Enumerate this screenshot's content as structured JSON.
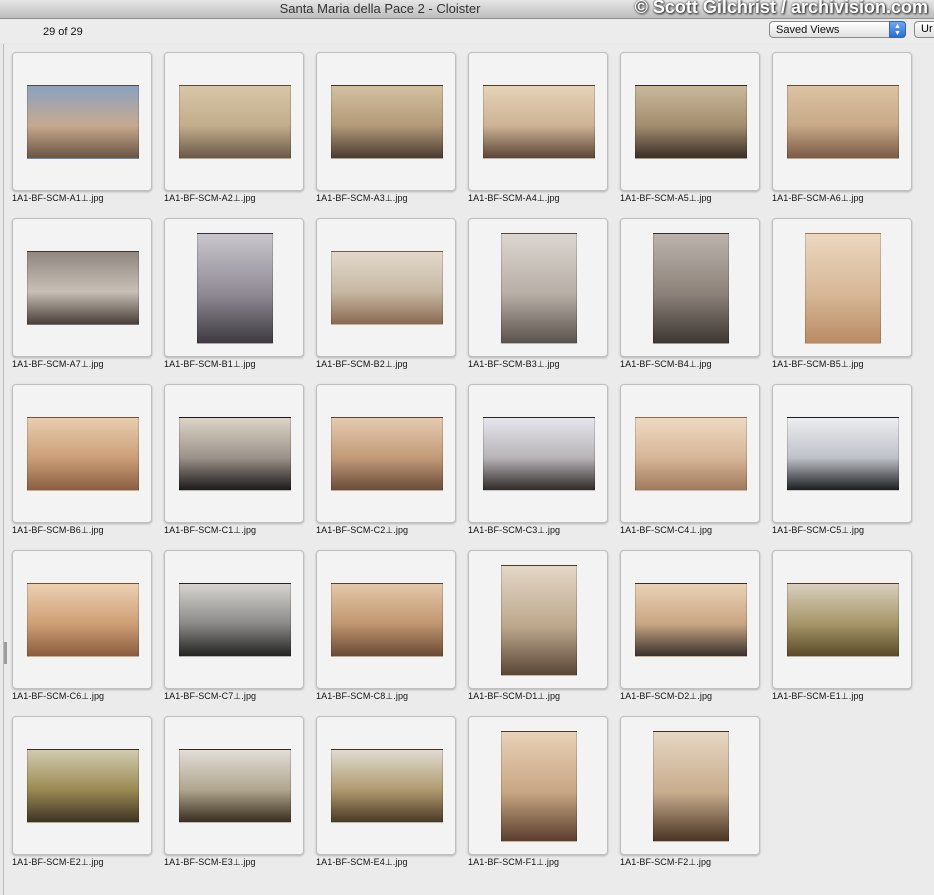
{
  "window": {
    "title": "Santa Maria della Pace 2 - Cloister"
  },
  "watermark": {
    "text": "© Scott Gilchrist / archivision.com"
  },
  "toolbar": {
    "item_count": "29 of 29",
    "saved_views_label": "Saved Views",
    "extra_button_label": "Ur"
  },
  "thumbnails": [
    {
      "filename": "1A1-BF-SCM-A1⊥.jpg",
      "orientation": "landscape",
      "colors": [
        "#8aa2c0",
        "#c7a98e",
        "#6a5444"
      ]
    },
    {
      "filename": "1A1-BF-SCM-A2⊥.jpg",
      "orientation": "landscape",
      "colors": [
        "#d7c6a6",
        "#c2ad8c",
        "#6b5848"
      ]
    },
    {
      "filename": "1A1-BF-SCM-A3⊥.jpg",
      "orientation": "landscape",
      "colors": [
        "#d3c0a0",
        "#b39a78",
        "#4a3a30"
      ]
    },
    {
      "filename": "1A1-BF-SCM-A4⊥.jpg",
      "orientation": "landscape",
      "colors": [
        "#e6d3b8",
        "#cdb394",
        "#5a4636"
      ]
    },
    {
      "filename": "1A1-BF-SCM-A5⊥.jpg",
      "orientation": "landscape",
      "colors": [
        "#c8b89a",
        "#a38d6e",
        "#3a2e26"
      ]
    },
    {
      "filename": "1A1-BF-SCM-A6⊥.jpg",
      "orientation": "landscape",
      "colors": [
        "#dcc3a3",
        "#c7a987",
        "#7a5a46"
      ]
    },
    {
      "filename": "1A1-BF-SCM-A7⊥.jpg",
      "orientation": "landscape",
      "colors": [
        "#8f8780",
        "#c8c0b6",
        "#4a3f3a"
      ]
    },
    {
      "filename": "1A1-BF-SCM-B1⊥.jpg",
      "orientation": "portrait",
      "colors": [
        "#c9c6cc",
        "#8f8a94",
        "#3e3a40"
      ]
    },
    {
      "filename": "1A1-BF-SCM-B2⊥.jpg",
      "orientation": "landscape",
      "colors": [
        "#e2d8cb",
        "#c7b8a4",
        "#8a6a50"
      ]
    },
    {
      "filename": "1A1-BF-SCM-B3⊥.jpg",
      "orientation": "portrait",
      "colors": [
        "#dcd6d0",
        "#b7aea6",
        "#5a524c"
      ]
    },
    {
      "filename": "1A1-BF-SCM-B4⊥.jpg",
      "orientation": "portrait",
      "colors": [
        "#bbb3ad",
        "#8c827a",
        "#3d3632"
      ]
    },
    {
      "filename": "1A1-BF-SCM-B5⊥.jpg",
      "orientation": "portrait",
      "colors": [
        "#ecd8c0",
        "#d6b796",
        "#b98c64"
      ]
    },
    {
      "filename": "1A1-BF-SCM-B6⊥.jpg",
      "orientation": "landscape",
      "colors": [
        "#e8cdb0",
        "#cc9f78",
        "#8a5e42"
      ]
    },
    {
      "filename": "1A1-BF-SCM-C1⊥.jpg",
      "orientation": "landscape",
      "colors": [
        "#ddd4c8",
        "#9b928a",
        "#1c1a1c"
      ]
    },
    {
      "filename": "1A1-BF-SCM-C2⊥.jpg",
      "orientation": "landscape",
      "colors": [
        "#e5cbb0",
        "#c29a78",
        "#6a4c3a"
      ]
    },
    {
      "filename": "1A1-BF-SCM-C3⊥.jpg",
      "orientation": "landscape",
      "colors": [
        "#e6e6ec",
        "#b8b4b8",
        "#302a28"
      ]
    },
    {
      "filename": "1A1-BF-SCM-C4⊥.jpg",
      "orientation": "landscape",
      "colors": [
        "#eed9c2",
        "#d6b697",
        "#a07a5c"
      ]
    },
    {
      "filename": "1A1-BF-SCM-C5⊥.jpg",
      "orientation": "landscape",
      "colors": [
        "#ecedf0",
        "#bfc2c8",
        "#1e1e22"
      ]
    },
    {
      "filename": "1A1-BF-SCM-C6⊥.jpg",
      "orientation": "landscape",
      "colors": [
        "#ecd0b2",
        "#cf9f76",
        "#8a5c3e"
      ]
    },
    {
      "filename": "1A1-BF-SCM-C7⊥.jpg",
      "orientation": "landscape",
      "colors": [
        "#d6d4d0",
        "#8c8a88",
        "#222422"
      ]
    },
    {
      "filename": "1A1-BF-SCM-C8⊥.jpg",
      "orientation": "landscape",
      "colors": [
        "#e4c8aa",
        "#c09670",
        "#6a4a34"
      ]
    },
    {
      "filename": "1A1-BF-SCM-D1⊥.jpg",
      "orientation": "portrait",
      "colors": [
        "#e3d7c6",
        "#bda88e",
        "#5a4636"
      ]
    },
    {
      "filename": "1A1-BF-SCM-D2⊥.jpg",
      "orientation": "landscape",
      "colors": [
        "#ead2b6",
        "#c9a683",
        "#3a322c"
      ]
    },
    {
      "filename": "1A1-BF-SCM-E1⊥.jpg",
      "orientation": "landscape",
      "colors": [
        "#d8cfbe",
        "#a69668",
        "#5a4a2a"
      ]
    },
    {
      "filename": "1A1-BF-SCM-E2⊥.jpg",
      "orientation": "landscape",
      "colors": [
        "#d2cbb0",
        "#9a8a52",
        "#3e3424"
      ]
    },
    {
      "filename": "1A1-BF-SCM-E3⊥.jpg",
      "orientation": "landscape",
      "colors": [
        "#e2ded8",
        "#b0a68e",
        "#3a2e20"
      ]
    },
    {
      "filename": "1A1-BF-SCM-E4⊥.jpg",
      "orientation": "landscape",
      "colors": [
        "#e0dcd2",
        "#b09a70",
        "#4a3a26"
      ]
    },
    {
      "filename": "1A1-BF-SCM-F1⊥.jpg",
      "orientation": "portrait",
      "colors": [
        "#e8d2b8",
        "#c8a683",
        "#5a3e2e"
      ]
    },
    {
      "filename": "1A1-BF-SCM-F2⊥.jpg",
      "orientation": "portrait",
      "colors": [
        "#e6d6c2",
        "#c8ad8e",
        "#4a3424"
      ]
    }
  ]
}
